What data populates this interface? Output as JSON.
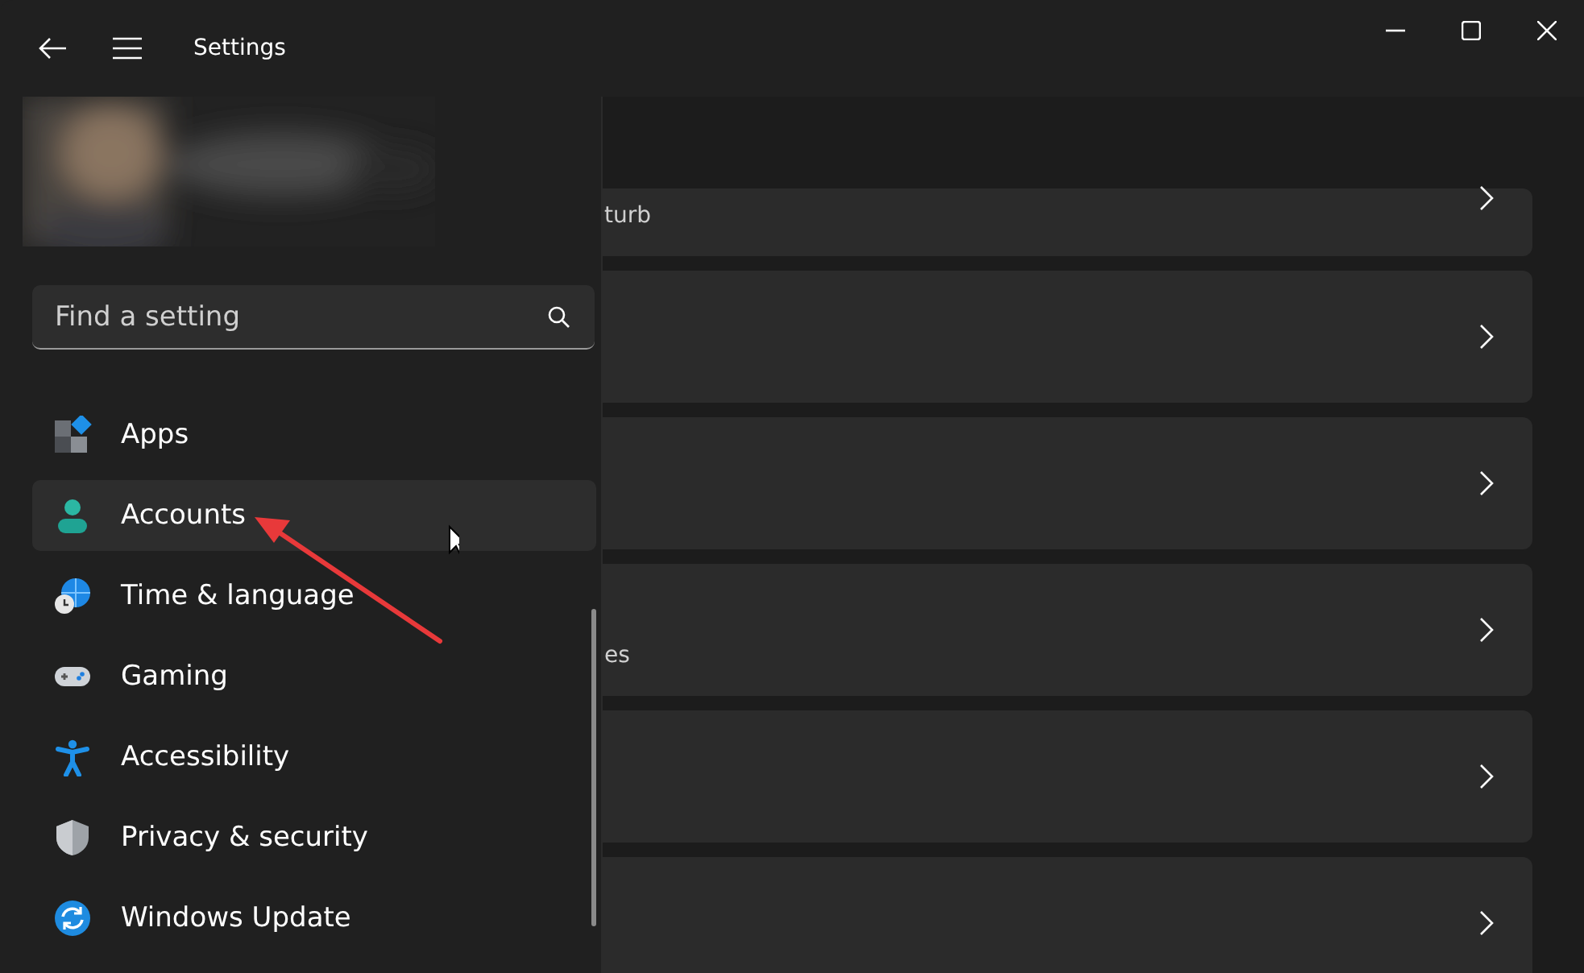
{
  "window": {
    "title": "Settings"
  },
  "search": {
    "placeholder": "Find a setting"
  },
  "nav_items": [
    {
      "label": "Apps",
      "kind": "apps",
      "selected": false
    },
    {
      "label": "Accounts",
      "kind": "accounts",
      "selected": true
    },
    {
      "label": "Time & language",
      "kind": "time",
      "selected": false
    },
    {
      "label": "Gaming",
      "kind": "gaming",
      "selected": false
    },
    {
      "label": "Accessibility",
      "kind": "accessibility",
      "selected": false
    },
    {
      "label": "Privacy & security",
      "kind": "privacy",
      "selected": false
    },
    {
      "label": "Windows Update",
      "kind": "update",
      "selected": false
    }
  ],
  "cards": [
    {
      "subtitle": "turb",
      "kind": "cut"
    },
    {
      "kind": "full"
    },
    {
      "kind": "full"
    },
    {
      "subtitle": "es",
      "kind": "full"
    },
    {
      "kind": "full"
    },
    {
      "kind": "full"
    }
  ]
}
